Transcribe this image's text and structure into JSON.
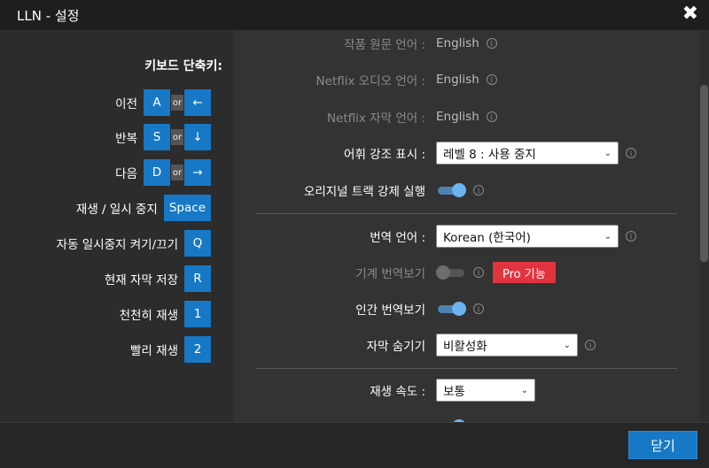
{
  "window": {
    "title": "LLN - 설정",
    "close_symbol": "✖"
  },
  "shortcuts": {
    "title": "키보드 단축키:",
    "or_label": "or",
    "items": [
      {
        "label": "이전",
        "key": "A",
        "alt": "←"
      },
      {
        "label": "반복",
        "key": "S",
        "alt": "↓"
      },
      {
        "label": "다음",
        "key": "D",
        "alt": "→"
      },
      {
        "label": "재생 / 일시 중지",
        "key": "Space"
      },
      {
        "label": "자동 일시중지 켜기/끄기",
        "key": "Q"
      },
      {
        "label": "현재 자막 저장",
        "key": "R"
      },
      {
        "label": "천천히 재생",
        "key": "1"
      },
      {
        "label": "빨리 재생",
        "key": "2"
      }
    ]
  },
  "settings": {
    "original_language": {
      "label": "작품 원문 언어 :",
      "value": "English"
    },
    "netflix_audio": {
      "label": "Netflix 오디오 언어 :",
      "value": "English"
    },
    "netflix_subtitle": {
      "label": "Netflix 자막 언어 :",
      "value": "English"
    },
    "vocab_highlight": {
      "label": "어휘 강조 표시 :",
      "value": "레벨 8 : 사용 중지"
    },
    "force_original_track": {
      "label": "오리지널 트랙 강제 실행",
      "on": true
    },
    "translation_language": {
      "label": "번역 언어 :",
      "value": "Korean (한국어)"
    },
    "machine_translation": {
      "label": "기계 번역보기",
      "on": false,
      "badge": "Pro 기능"
    },
    "human_translation": {
      "label": "인간 번역보기",
      "on": true
    },
    "hide_subtitles": {
      "label": "자막 숨기기",
      "value": "비활성화"
    },
    "playback_speed": {
      "label": "재생 속도 :",
      "value": "보통"
    }
  },
  "icons": {
    "info": "i",
    "chevron": "⌄"
  },
  "colors": {
    "accent": "#1778c5",
    "pro": "#e1343f",
    "toggle_on": "#6cb4f0"
  },
  "footer": {
    "close_label": "닫기"
  }
}
